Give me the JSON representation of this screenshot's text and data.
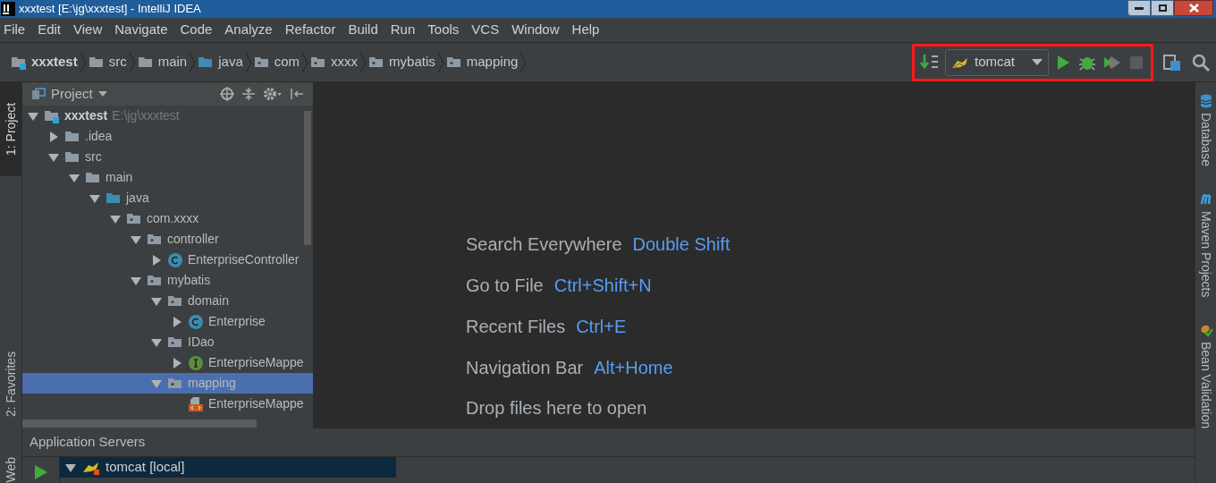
{
  "window": {
    "title": "xxxtest [E:\\jg\\xxxtest] - IntelliJ IDEA"
  },
  "menu": [
    {
      "label": "File"
    },
    {
      "label": "Edit"
    },
    {
      "label": "View"
    },
    {
      "label": "Navigate"
    },
    {
      "label": "Code"
    },
    {
      "label": "Analyze"
    },
    {
      "label": "Refactor"
    },
    {
      "label": "Build"
    },
    {
      "label": "Run"
    },
    {
      "label": "Tools"
    },
    {
      "label": "VCS"
    },
    {
      "label": "Window"
    },
    {
      "label": "Help"
    }
  ],
  "breadcrumbs": [
    {
      "label": "xxxtest",
      "kind": "module"
    },
    {
      "label": "src",
      "kind": "folder"
    },
    {
      "label": "main",
      "kind": "folder"
    },
    {
      "label": "java",
      "kind": "source"
    },
    {
      "label": "com",
      "kind": "package"
    },
    {
      "label": "xxxx",
      "kind": "package"
    },
    {
      "label": "mybatis",
      "kind": "package"
    },
    {
      "label": "mapping",
      "kind": "package"
    }
  ],
  "run_config": {
    "label": "tomcat"
  },
  "left_tool_windows": [
    {
      "label": "1: Project",
      "selected": true
    },
    {
      "label": "2: Favorites",
      "selected": false
    },
    {
      "label": "Web",
      "selected": false
    }
  ],
  "project_panel": {
    "title": "Project",
    "tree": [
      {
        "label": "xxxtest",
        "hint": "E:\\jg\\xxxtest",
        "kind": "module",
        "expanded": true,
        "selected": false,
        "children": [
          {
            "label": ".idea",
            "kind": "folder",
            "expanded": false,
            "selected": false
          },
          {
            "label": "src",
            "kind": "folder",
            "expanded": true,
            "selected": false,
            "children": [
              {
                "label": "main",
                "kind": "folder",
                "expanded": true,
                "selected": false,
                "children": [
                  {
                    "label": "java",
                    "kind": "source",
                    "expanded": true,
                    "selected": false,
                    "children": [
                      {
                        "label": "com.xxxx",
                        "kind": "package",
                        "expanded": true,
                        "selected": false,
                        "children": [
                          {
                            "label": "controller",
                            "kind": "package",
                            "expanded": true,
                            "selected": false,
                            "children": [
                              {
                                "label": "EnterpriseController",
                                "kind": "class",
                                "expanded": false,
                                "selected": false
                              }
                            ]
                          },
                          {
                            "label": "mybatis",
                            "kind": "package",
                            "expanded": true,
                            "selected": false,
                            "children": [
                              {
                                "label": "domain",
                                "kind": "package",
                                "expanded": true,
                                "selected": false,
                                "children": [
                                  {
                                    "label": "Enterprise",
                                    "kind": "class",
                                    "expanded": false,
                                    "selected": false
                                  }
                                ]
                              },
                              {
                                "label": "IDao",
                                "kind": "package",
                                "expanded": true,
                                "selected": false,
                                "children": [
                                  {
                                    "label": "EnterpriseMappe",
                                    "kind": "interface",
                                    "expanded": false,
                                    "selected": false
                                  }
                                ]
                              },
                              {
                                "label": "mapping",
                                "kind": "package",
                                "expanded": true,
                                "selected": true,
                                "children": [
                                  {
                                    "label": "EnterpriseMappe",
                                    "kind": "xml",
                                    "selected": false
                                  }
                                ]
                              }
                            ]
                          }
                        ]
                      }
                    ]
                  }
                ]
              }
            ]
          }
        ]
      }
    ]
  },
  "editor_hints": [
    {
      "action": "Search Everywhere",
      "shortcut": "Double Shift"
    },
    {
      "action": "Go to File",
      "shortcut": "Ctrl+Shift+N"
    },
    {
      "action": "Recent Files",
      "shortcut": "Ctrl+E"
    },
    {
      "action": "Navigation Bar",
      "shortcut": "Alt+Home"
    }
  ],
  "drop_hint": "Drop files here to open",
  "right_tool_windows": [
    {
      "label": "Database",
      "kind": "database"
    },
    {
      "label": "Maven Projects",
      "kind": "maven"
    },
    {
      "label": "Bean Validation",
      "kind": "bean"
    }
  ],
  "bottom_panel": {
    "title": "Application Servers",
    "servers": [
      {
        "label": "tomcat [local]",
        "expanded": true,
        "selected": true
      }
    ]
  }
}
